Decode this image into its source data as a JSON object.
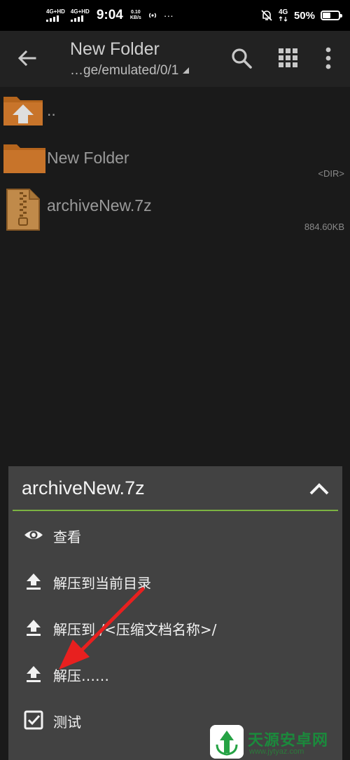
{
  "status_bar": {
    "net1": "4G+HD",
    "net2": "4G+HD",
    "time": "9:04",
    "speed_value": "0.10",
    "speed_unit": "KB/s",
    "more": "···",
    "lte": "4G",
    "battery_pct": "50%",
    "battery_level": 0.5
  },
  "toolbar": {
    "title": "New Folder",
    "path": "…ge/emulated/0/1",
    "icons": [
      "back-arrow-icon",
      "search-icon",
      "grid-view-icon",
      "more-vert-icon"
    ]
  },
  "files": [
    {
      "name": "..",
      "info": "",
      "icon": "folder-up-icon"
    },
    {
      "name": "New Folder",
      "info": "<DIR>",
      "icon": "folder-icon"
    },
    {
      "name": "archiveNew.7z",
      "info": "884.60KB",
      "icon": "archive-icon"
    }
  ],
  "context_menu": {
    "title": "archiveNew.7z",
    "accent_color": "#7cb342",
    "items": [
      {
        "label": "查看",
        "icon": "eye-icon"
      },
      {
        "label": "解压到当前目录",
        "icon": "extract-icon"
      },
      {
        "label": "解压到./<压缩文档名称>/",
        "icon": "extract-icon"
      },
      {
        "label": "解压……",
        "icon": "extract-icon"
      },
      {
        "label": "测试",
        "icon": "checkbox-icon"
      }
    ]
  },
  "annotation": {
    "color": "#e8201f"
  },
  "watermark": {
    "name": "天源安卓网",
    "url": "www.jytyaz.com"
  }
}
